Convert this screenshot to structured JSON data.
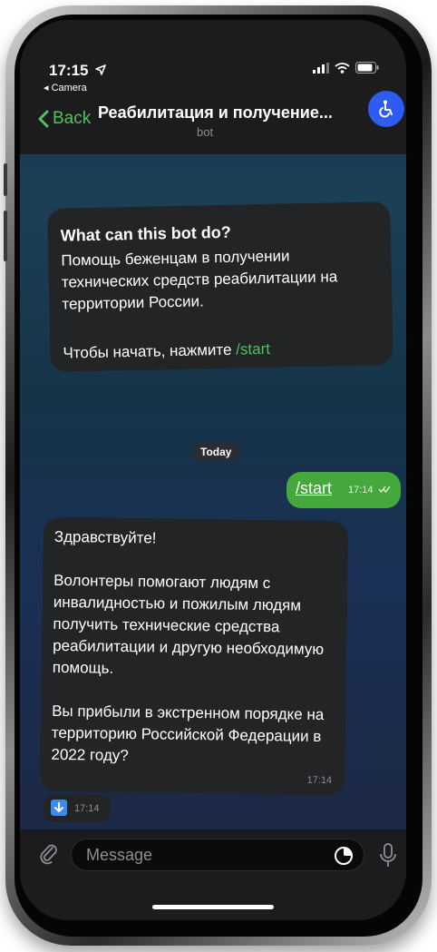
{
  "status": {
    "time": "17:15",
    "back_app": "◂ Camera",
    "location_arrow": "location-arrow-icon",
    "signal": "signal-bars-icon",
    "wifi": "wifi-icon",
    "battery": "battery-icon"
  },
  "nav": {
    "back_label": "Back",
    "title": "Реабилитация и получение...",
    "subtitle": "bot",
    "avatar_icon": "wheelchair-icon"
  },
  "bot_info": {
    "title": "What can this bot do?",
    "description": "Помощь беженцам в получении технических средств реабилитации на территории России.",
    "start_prefix": "Чтобы начать, нажмите ",
    "start_command": "/start"
  },
  "date_separator": "Today",
  "messages": [
    {
      "direction": "outgoing",
      "text": "/start",
      "time": "17:14",
      "status": "read-checks-icon"
    },
    {
      "direction": "incoming",
      "paragraphs": [
        "Здравствуйте!",
        "Волонтеры помогают людям с инвалидностью и пожилым людям получить технические средства реабилитации и другую необходимую помощь.",
        "Вы прибыли в экстренном порядке на территорию Российской Федерации в 2022 году?"
      ],
      "time": "17:14"
    },
    {
      "direction": "incoming",
      "icon": "down-arrow-icon",
      "time": "17:14"
    }
  ],
  "composer": {
    "placeholder": "Message",
    "attach_icon": "paperclip-icon",
    "sticker_icon": "sticker-icon",
    "mic_icon": "microphone-icon"
  },
  "colors": {
    "accent_green": "#4fc35e",
    "outgoing_bubble": "#44a83d",
    "incoming_bubble": "#222426",
    "avatar_blue": "#2f5cf0"
  }
}
